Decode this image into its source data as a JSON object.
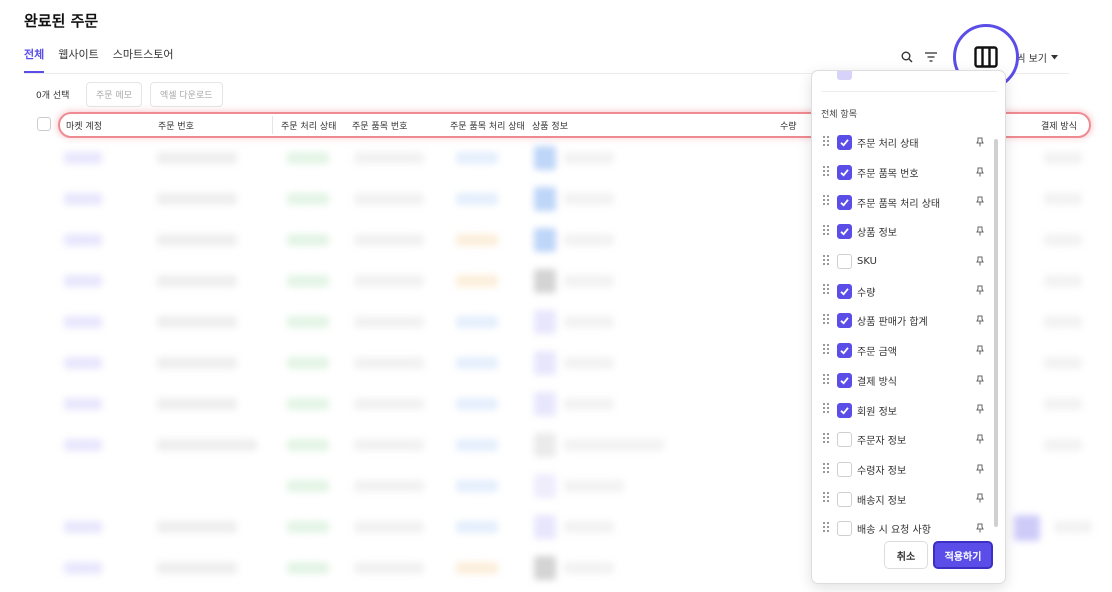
{
  "page": {
    "title": "완료된 주문"
  },
  "tabs": [
    {
      "label": "전체",
      "active": true
    },
    {
      "label": "웹사이트",
      "active": false
    },
    {
      "label": "스마트스토어",
      "active": false
    }
  ],
  "toolbar": {
    "view_label": "씩 보기"
  },
  "actions": {
    "selected_count": "0개 선택",
    "memo_label": "주문 메모",
    "excel_label": "엑셀 다운로드"
  },
  "table": {
    "columns": [
      "마켓 계정",
      "주문 번호",
      "주문 처리 상태",
      "주문 품목 번호",
      "주문 품목 처리 상태",
      "상품 정보",
      "수량",
      "결제 방식"
    ]
  },
  "column_panel": {
    "section_label": "전체 항목",
    "items": [
      {
        "label": "주문 처리 상태",
        "checked": true
      },
      {
        "label": "주문 품목 번호",
        "checked": true
      },
      {
        "label": "주문 품목 처리 상태",
        "checked": true
      },
      {
        "label": "상품 정보",
        "checked": true
      },
      {
        "label": "SKU",
        "checked": false
      },
      {
        "label": "수량",
        "checked": true
      },
      {
        "label": "상품 판매가 합계",
        "checked": true
      },
      {
        "label": "주문 금액",
        "checked": true
      },
      {
        "label": "결제 방식",
        "checked": true
      },
      {
        "label": "회원 정보",
        "checked": true
      },
      {
        "label": "주문자 정보",
        "checked": false
      },
      {
        "label": "수령자 정보",
        "checked": false
      },
      {
        "label": "배송지 정보",
        "checked": false
      },
      {
        "label": "배송 시 요청 사항",
        "checked": false
      }
    ],
    "cancel_label": "취소",
    "apply_label": "적용하기"
  },
  "colors": {
    "accent": "#5b4ee8",
    "highlight": "#ef8a92"
  }
}
